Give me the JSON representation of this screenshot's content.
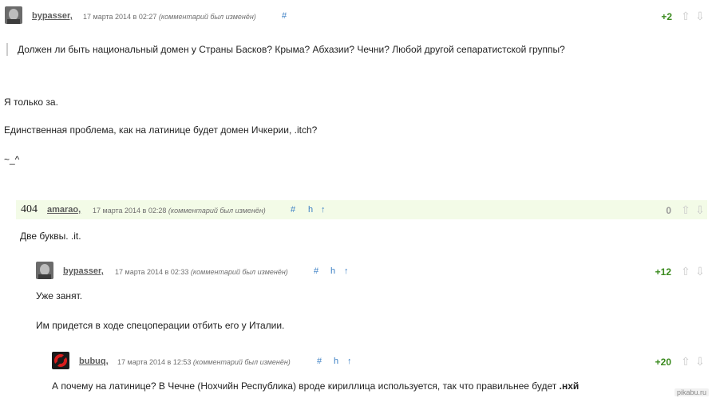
{
  "comments": [
    {
      "author": "bypasser,",
      "date": "17 марта 2014 в 02:27",
      "edited": "(комментарий был изменён)",
      "hash": "#",
      "score": "+2",
      "quote": "Должен ли быть национальный домен у Страны Басков? Крыма? Абхазии? Чечни? Любой другой сепаратистской группы?",
      "paragraphs": [
        "Я только за.",
        "Единственная проблема, как на латинице будет домен Ичкерии, .itch?",
        "~_^"
      ]
    },
    {
      "number": "404",
      "author": "amarao,",
      "date": "17 марта 2014 в 02:28",
      "edited": "(комментарий был изменён)",
      "hash": "#",
      "reply_icon": "h",
      "up_icon": "↑",
      "score": "0",
      "paragraphs": [
        "Две буквы. .it."
      ]
    },
    {
      "author": "bypasser,",
      "date": "17 марта 2014 в 02:33",
      "edited": "(комментарий был изменён)",
      "hash": "#",
      "reply_icon": "h",
      "up_icon": "↑",
      "score": "+12",
      "paragraphs": [
        "Уже занят.",
        "Им придется в ходе спецоперации отбить его у Италии."
      ]
    },
    {
      "author": "bubuq,",
      "date": "17 марта 2014 в 12:53",
      "edited": "(комментарий был изменён)",
      "hash": "#",
      "reply_icon": "h",
      "up_icon": "↑",
      "score": "+20",
      "text_before": "А почему на латинице? В Чечне (Нохчийн Республика) вроде кириллица используется, так что правильнее будет ",
      "text_bold": ".нхй"
    }
  ],
  "vote": {
    "up": "⇧",
    "down": "⇩"
  },
  "watermark": "pikabu.ru",
  "colors": {
    "score_positive": "#3a8a1e",
    "score_zero": "#999999",
    "link": "#3b7fc4",
    "highlight": "#f3fbe7"
  }
}
